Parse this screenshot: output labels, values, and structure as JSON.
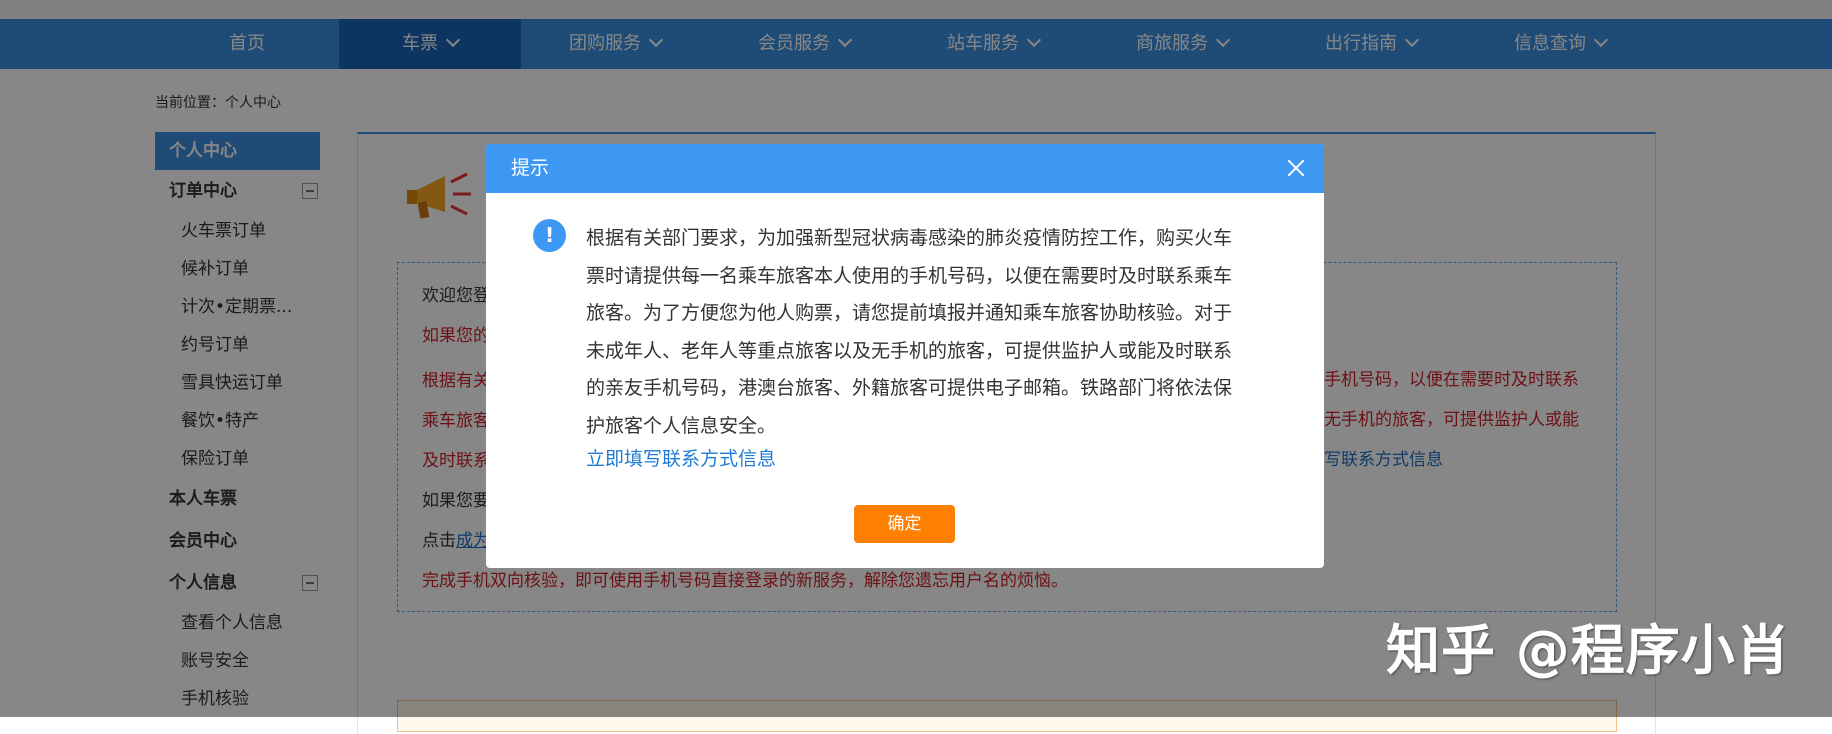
{
  "nav": {
    "items": [
      {
        "label": "首页"
      },
      {
        "label": "车票"
      },
      {
        "label": "团购服务"
      },
      {
        "label": "会员服务"
      },
      {
        "label": "站车服务"
      },
      {
        "label": "商旅服务"
      },
      {
        "label": "出行指南"
      },
      {
        "label": "信息查询"
      }
    ]
  },
  "breadcrumb": "当前位置：个人中心",
  "sidebar": {
    "header": "个人中心",
    "order_center": "订单中心",
    "orders": [
      "火车票订单",
      "候补订单",
      "计次•定期票...",
      "约号订单",
      "雪具快运订单",
      "餐饮•特产",
      "保险订单"
    ],
    "my_tickets": "本人车票",
    "member_center": "会员中心",
    "personal_info": "个人信息",
    "info_items": [
      "查看个人信息",
      "账号安全",
      "手机核验"
    ]
  },
  "notice": {
    "welcome": "欢迎您登",
    "line2": "如果您的",
    "line3_left": "根据有关",
    "line3_right": "手机号码，以便在需要时及时联系",
    "line4_left": "乘车旅客",
    "line4_right": "无手机的旅客，可提供监护人或能",
    "line5_left": "及时联系",
    "line5_right": "写联系方式信息",
    "line6": "如果您要",
    "line7_prefix": "点击",
    "line7_link": "成为",
    "line8": "完成手机双向核验，即可使用手机号码直接登录的新服务，解除您遗忘用户名的烦恼。"
  },
  "dialog": {
    "title": "提示",
    "lines": [
      "根据有关部门要求，为加强新型冠状病毒感染的肺炎疫情防控工作，购买火车",
      "票时请提供每一名乘车旅客本人使用的手机号码，以便在需要时及时联系乘车",
      "旅客。为了方便您为他人购票，请您提前填报并通知乘车旅客协助核验。对于",
      "未成年人、老年人等重点旅客以及无手机的旅客，可提供监护人或能及时联系",
      "的亲友手机号码，港澳台旅客、外籍旅客可提供电子邮箱。铁路部门将依法保",
      "护旅客个人信息安全。"
    ],
    "link": "立即填写联系方式信息",
    "ok": "确定"
  },
  "watermark": "知乎 @程序小肖",
  "colors": {
    "nav": "#3b8fe0",
    "nav_active": "#1b62b7",
    "dialog_header": "#3c98f3",
    "ok_button": "#ff7f00",
    "notice_red": "#d0202a"
  }
}
